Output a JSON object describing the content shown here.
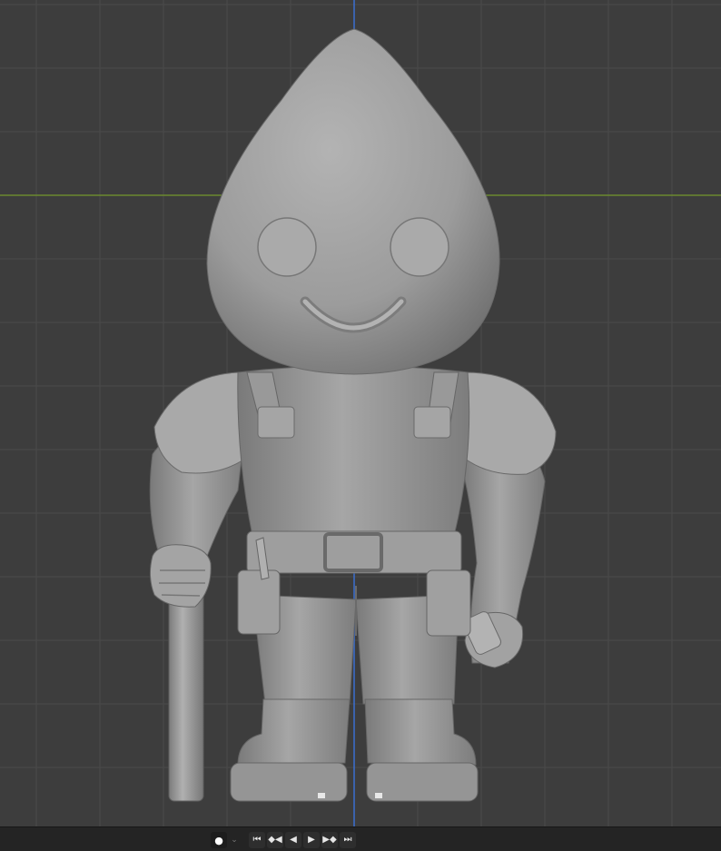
{
  "viewport": {
    "background": "#3d3d3d",
    "grid_color": "#4a4a4a",
    "axis_x_color": "#6b8a2e",
    "axis_z_color": "#3b6fd1",
    "model_color": "#9a9a9a"
  },
  "timeline": {
    "controls": [
      {
        "name": "keyframe-dot-icon",
        "glyph": "●"
      },
      {
        "name": "keying-dropdown-icon",
        "glyph": "⌄"
      },
      {
        "name": "jump-to-start-icon",
        "glyph": "⏮"
      },
      {
        "name": "jump-to-prev-keyframe-icon",
        "glyph": "◆◀"
      },
      {
        "name": "play-reverse-icon",
        "glyph": "◀"
      },
      {
        "name": "play-icon",
        "glyph": "▶"
      },
      {
        "name": "jump-to-next-keyframe-icon",
        "glyph": "▶◆"
      },
      {
        "name": "jump-to-end-icon",
        "glyph": "⏭"
      }
    ]
  }
}
